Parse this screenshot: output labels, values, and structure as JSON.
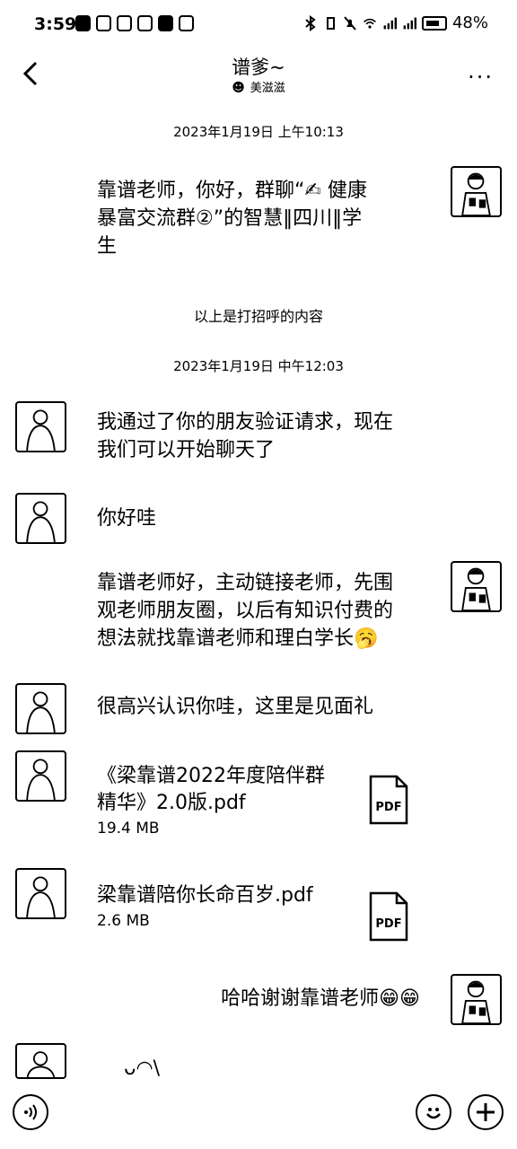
{
  "status_bar": {
    "time": "3:59",
    "battery": "48%"
  },
  "header": {
    "title": "谱爹~",
    "subtitle": "美滋滋"
  },
  "messages": {
    "ts1": "2023年1月19日 上午10:13",
    "m1": [
      "靠谱老师，你好，群聊“✍ 健康",
      "暴富交流群②”的智慧‖四川‖学",
      "生"
    ],
    "notice": "以上是打招呼的内容",
    "ts2": "2023年1月19日 中午12:03",
    "m2": [
      "我通过了你的朋友验证请求，现在",
      "我们可以开始聊天了"
    ],
    "m3": "你好哇",
    "m4": [
      "靠谱老师好，主动链接老师，先围",
      "观老师朋友圈，以后有知识付费的",
      "想法就找靠谱老师和理白学长🥱"
    ],
    "m5": "很高兴认识你哇，这里是见面礼",
    "file1": {
      "name": [
        "《梁靠谱2022年度陪伴群",
        "精华》2.0版.pdf"
      ],
      "size": "19.4 MB",
      "icon": "PDF"
    },
    "file2": {
      "name": "梁靠谱陪你长命百岁.pdf",
      "size": "2.6 MB",
      "icon": "PDF"
    },
    "m6": "哈哈谢谢靠谱老师😁😁",
    "m7": "ᴗ◠\\"
  }
}
